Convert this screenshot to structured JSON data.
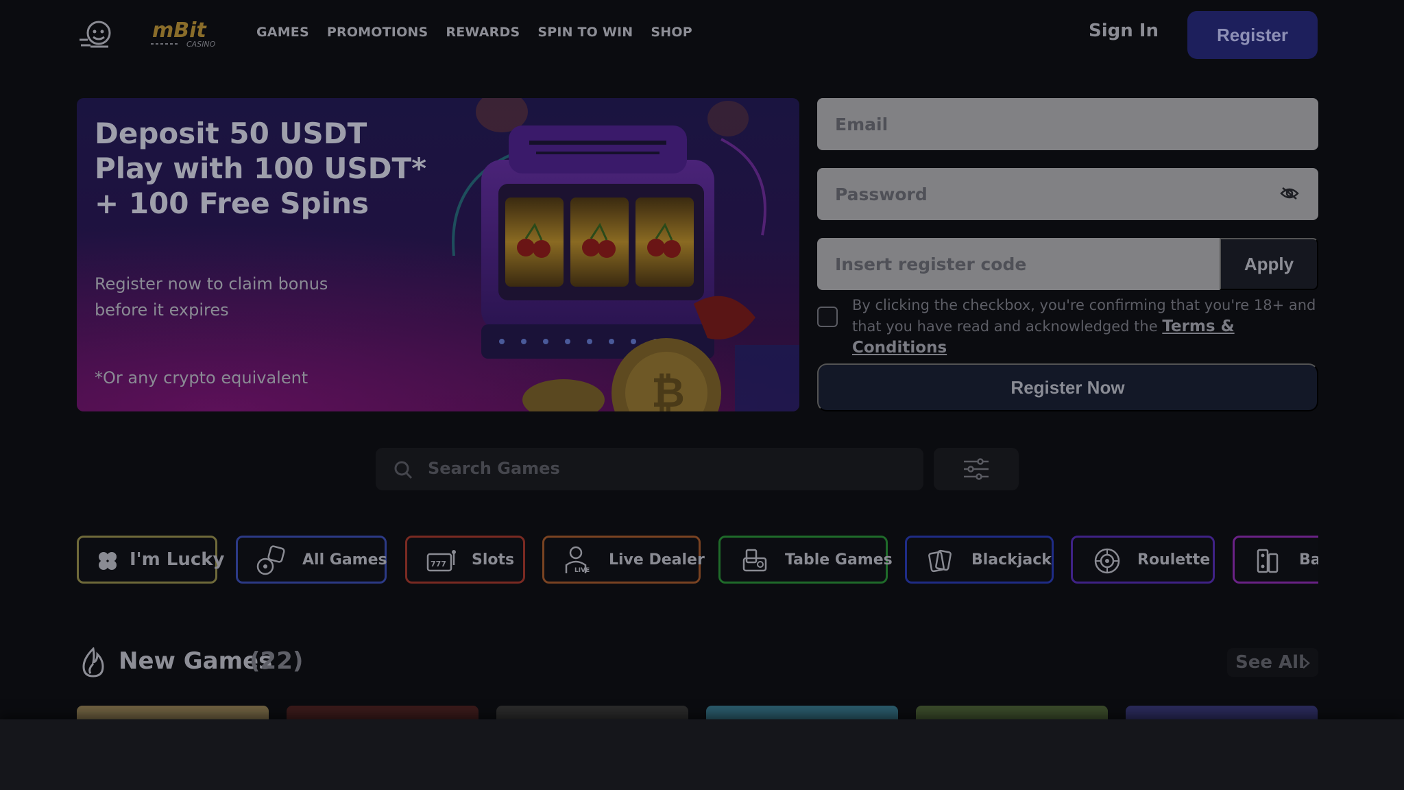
{
  "header": {
    "nav": [
      "GAMES",
      "PROMOTIONS",
      "REWARDS",
      "SPIN TO WIN",
      "SHOP"
    ],
    "sign_in": "Sign In",
    "register": "Register",
    "brand_logo_text": "mBit CASINO"
  },
  "banner": {
    "title_lines": [
      "Deposit 50 USDT",
      "Play with 100 USDT*",
      "+ 100 Free Spins"
    ],
    "subtitle": "Register now to claim bonus before it expires",
    "note": "*Or any crypto equivalent"
  },
  "form": {
    "email_placeholder": "Email",
    "password_placeholder": "Password",
    "code_placeholder": "Insert register code",
    "apply": "Apply",
    "terms_text": "By clicking the checkbox, you're confirming that you're 18+ and that you have read and acknowledged the",
    "terms_link": "Terms & Conditions",
    "register_now": "Register Now"
  },
  "search": {
    "placeholder": "Search Games"
  },
  "categories": [
    {
      "label": "I'm Lucky",
      "icon": "clover-icon",
      "color": "#6f6a3a"
    },
    {
      "label": "All Games",
      "icon": "dice-icon",
      "color": "#2c3a86"
    },
    {
      "label": "Slots",
      "icon": "slot-machine-icon",
      "color": "#7a2a22"
    },
    {
      "label": "Live Dealer",
      "icon": "live-dealer-icon",
      "color": "#7a4322"
    },
    {
      "label": "Table Games",
      "icon": "table-games-icon",
      "color": "#1f6b2a"
    },
    {
      "label": "Blackjack",
      "icon": "cards-icon",
      "color": "#1f2c86"
    },
    {
      "label": "Roulette",
      "icon": "roulette-icon",
      "color": "#3f2286"
    },
    {
      "label": "Bac",
      "icon": "baccarat-icon",
      "color": "#6a2286"
    }
  ],
  "new_games": {
    "title": "New Games",
    "count": "(22)",
    "see_all": "See All"
  }
}
